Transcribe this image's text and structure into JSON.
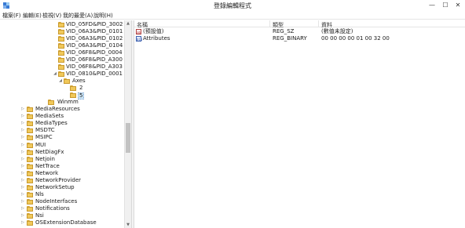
{
  "window": {
    "title": "登錄編輯程式",
    "min_glyph": "—",
    "max_glyph": "☐",
    "close_glyph": "✕",
    "app_icon": "registry-editor-icon"
  },
  "menu": [
    "檔案(F)",
    "編輯(E)",
    "檢視(V)",
    "我的最愛(A)",
    "說明(H)"
  ],
  "tree": {
    "items": [
      {
        "label": "VID_05FD&PID_3002",
        "expander": ""
      },
      {
        "label": "VID_06A3&PID_0101",
        "expander": ""
      },
      {
        "label": "VID_06A3&PID_0102",
        "expander": ""
      },
      {
        "label": "VID_06A3&PID_0104",
        "expander": ""
      },
      {
        "label": "VID_06F8&PID_0004",
        "expander": ""
      },
      {
        "label": "VID_06F8&PID_A300",
        "expander": ""
      },
      {
        "label": "VID_06F8&PID_A303",
        "expander": ""
      },
      {
        "label": "VID_0810&PID_0001",
        "expander": "◢"
      },
      {
        "label": "Axes",
        "expander": "◢"
      },
      {
        "label": "2",
        "expander": ""
      },
      {
        "label": "5",
        "expander": "",
        "selected": true
      },
      {
        "label": "Winmm",
        "expander": ""
      },
      {
        "label": "MediaResources",
        "expander": "▷"
      },
      {
        "label": "MediaSets",
        "expander": "▷"
      },
      {
        "label": "MediaTypes",
        "expander": "▷"
      },
      {
        "label": "MSDTC",
        "expander": "▷"
      },
      {
        "label": "MSIPC",
        "expander": "▷"
      },
      {
        "label": "MUI",
        "expander": "▷"
      },
      {
        "label": "NetDiagFx",
        "expander": "▷"
      },
      {
        "label": "Netjoin",
        "expander": "▷"
      },
      {
        "label": "NetTrace",
        "expander": "▷"
      },
      {
        "label": "Network",
        "expander": "▷"
      },
      {
        "label": "NetworkProvider",
        "expander": "▷"
      },
      {
        "label": "NetworkSetup",
        "expander": "▷"
      },
      {
        "label": "Nls",
        "expander": "▷"
      },
      {
        "label": "NodeInterfaces",
        "expander": "▷"
      },
      {
        "label": "Notifications",
        "expander": "▷"
      },
      {
        "label": "Nsi",
        "expander": "▷"
      },
      {
        "label": "OSExtensionDatabase",
        "expander": "▷"
      }
    ]
  },
  "scrollbar": {
    "up_glyph": "▲",
    "down_glyph": "▼"
  },
  "values": {
    "columns": [
      "名稱",
      "類型",
      "資料"
    ],
    "rows": [
      {
        "name": "(預設值)",
        "type": "REG_SZ",
        "data": "(數值未設定)",
        "icon": "ab",
        "icon_name": "string-value-icon"
      },
      {
        "name": "Attributes",
        "type": "REG_BINARY",
        "data": "00 00 00 00 01 00 32 00",
        "icon": "011",
        "icon_name": "binary-value-icon"
      }
    ]
  }
}
